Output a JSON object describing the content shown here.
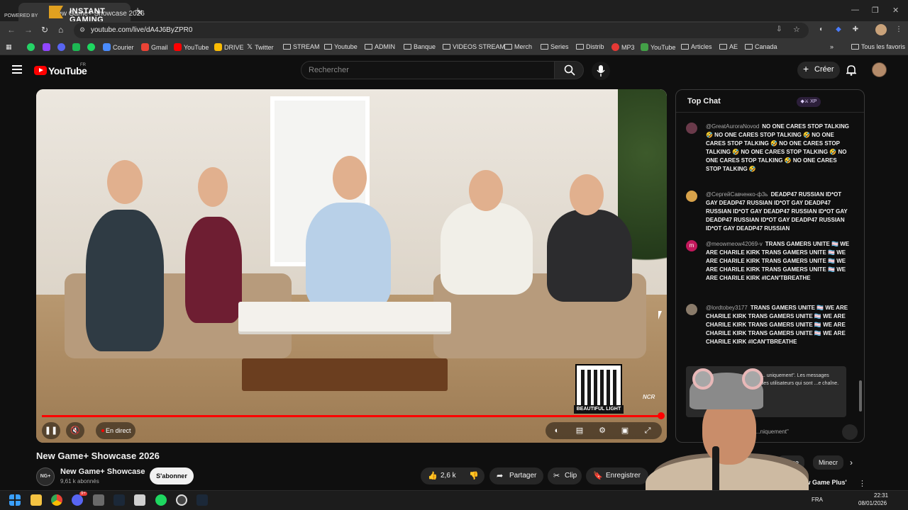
{
  "browser": {
    "tab_title": "New Game+ Showcase 2026",
    "promo": {
      "powered_by": "POWERED BY",
      "line1": "INSTANT",
      "line2": "GAMING"
    },
    "url": "youtube.com/live/dA4J6ByZPR0",
    "bookmarks": [
      "Courier",
      "Gmail",
      "YouTube",
      "DRIVE",
      "Twitter",
      "STREAM",
      "Youtube",
      "ADMIN",
      "Banque",
      "VIDEOS STREAM",
      "Merch",
      "Series",
      "Distrib",
      "MP3",
      "YouTube",
      "Articles",
      "AE",
      "Canada"
    ],
    "all_bookmarks": "Tous les favoris"
  },
  "header": {
    "logo": "YouTube",
    "region": "FR",
    "search_placeholder": "Rechercher",
    "create_label": "Créer",
    "create_icon": "plus-icon"
  },
  "player": {
    "live_label": "En direct",
    "progress": 1.0,
    "qr_label": "BEAUTIFUL LIGHT",
    "watermark": "NCR"
  },
  "video": {
    "title": "New Game+ Showcase 2026",
    "channel_avatar": "NG+",
    "channel_name": "New Game+ Showcase",
    "subscribers": "9,61 k abonnés",
    "subscribe_label": "S'abonner",
    "likes": "2,6 k",
    "share_label": "Partager",
    "clip_label": "Clip",
    "save_label": "Enregistrer"
  },
  "chat": {
    "title": "Top Chat",
    "pill": "◆⚔ XP",
    "messages": [
      {
        "author": "@GreatAuroraNovod",
        "text": "NO ONE CARES STOP TALKING 🤣 NO ONE CARES STOP TALKING 🤣 NO ONE CARES STOP TALKING 🤣 NO ONE CARES STOP TALKING 🤣 NO ONE CARES STOP TALKING 🤣 NO ONE CARES STOP TALKING 🤣 NO ONE CARES STOP TALKING 🤣",
        "avatar_color": "#6a3a4a"
      },
      {
        "author": "@СергейСавченко-ф3ь",
        "text": "DEADP47 RUSSIAN ID*OT GAY DEADP47 RUSSIAN ID*OT GAY DEADP47 RUSSIAN ID*OT GAY DEADP47 RUSSIAN ID*OT GAY DEADP47 RUSSIAN ID*OT GAY DEADP47 RUSSIAN ID*OT GAY DEADP47 RUSSIAN",
        "avatar_color": "#d8a24a"
      },
      {
        "author": "@meowmeow42069-v",
        "text": "TRANS GAMERS UNITE 🏳️‍⚧️ WE ARE CHARILE KIRK TRANS GAMERS UNITE 🏳️‍⚧️ WE ARE CHARILE KIRK TRANS GAMERS UNITE 🏳️‍⚧️ WE ARE CHARILE KIRK TRANS GAMERS UNITE 🏳️‍⚧️ WE ARE CHARILE KIRK #ICAN'TBREATHE",
        "avatar_color": "#c2185b",
        "avatar_letter": "m"
      },
      {
        "author": "@lordtobey3177",
        "text": "TRANS GAMERS UNITE 🏳️‍⚧️ WE ARE CHARILE KIRK TRANS GAMERS UNITE 🏳️‍⚧️ WE ARE CHARILE KIRK TRANS GAMERS UNITE 🏳️‍⚧️ WE ARE CHARILE KIRK TRANS GAMERS UNITE 🏳️‍⚧️ WE ARE CHARILE KIRK #ICAN'TBREATHE",
        "avatar_color": "#8a7b6a"
      }
    ],
    "mode_notice": "Mode \"... uniquement\". Les messages ...nent des utilisateurs qui sont ...e chaîne.",
    "input_partial": "...niquement\""
  },
  "overlay_chips": [
    "...ase",
    "Minecr"
  ],
  "recommended_partial": "...w Game Plus'",
  "taskbar": {
    "lang": "FRA",
    "time": "22:31",
    "date": "08/01/2026",
    "discord_badge": "9+"
  }
}
